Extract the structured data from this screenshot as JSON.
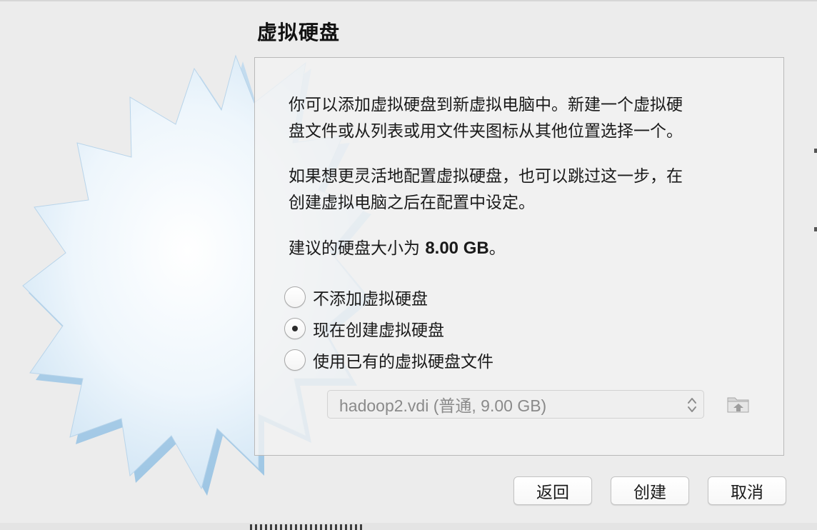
{
  "dialog": {
    "title": "虚拟硬盘",
    "intro_line1": "你可以添加虚拟硬盘到新虚拟电脑中。新建一个虚拟硬",
    "intro_line2": "盘文件或从列表或用文件夹图标从其他位置选择一个。",
    "flex_line1": "如果想更灵活地配置虚拟硬盘，也可以跳过这一步，在",
    "flex_line2": "创建虚拟电脑之后在配置中设定。",
    "recommend_prefix": "建议的硬盘大小为 ",
    "recommend_size": "8.00 GB",
    "recommend_suffix": "。"
  },
  "options": [
    {
      "label": "不添加虚拟硬盘",
      "checked": false
    },
    {
      "label": "现在创建虚拟硬盘",
      "checked": true
    },
    {
      "label": "使用已有的虚拟硬盘文件",
      "checked": false
    }
  ],
  "existing_disk_select": {
    "value": "hadoop2.vdi (普通, 9.00 GB)",
    "disabled": true
  },
  "buttons": {
    "back": "返回",
    "create": "创建",
    "cancel": "取消"
  },
  "icons": {
    "folder": "folder-icon",
    "stepper": "chevron-updown-icon"
  },
  "colors": {
    "background": "#ececec",
    "panel_border": "#b9b9b9",
    "star_light": "#e6f2fb",
    "star_edge": "#a9cde8"
  }
}
